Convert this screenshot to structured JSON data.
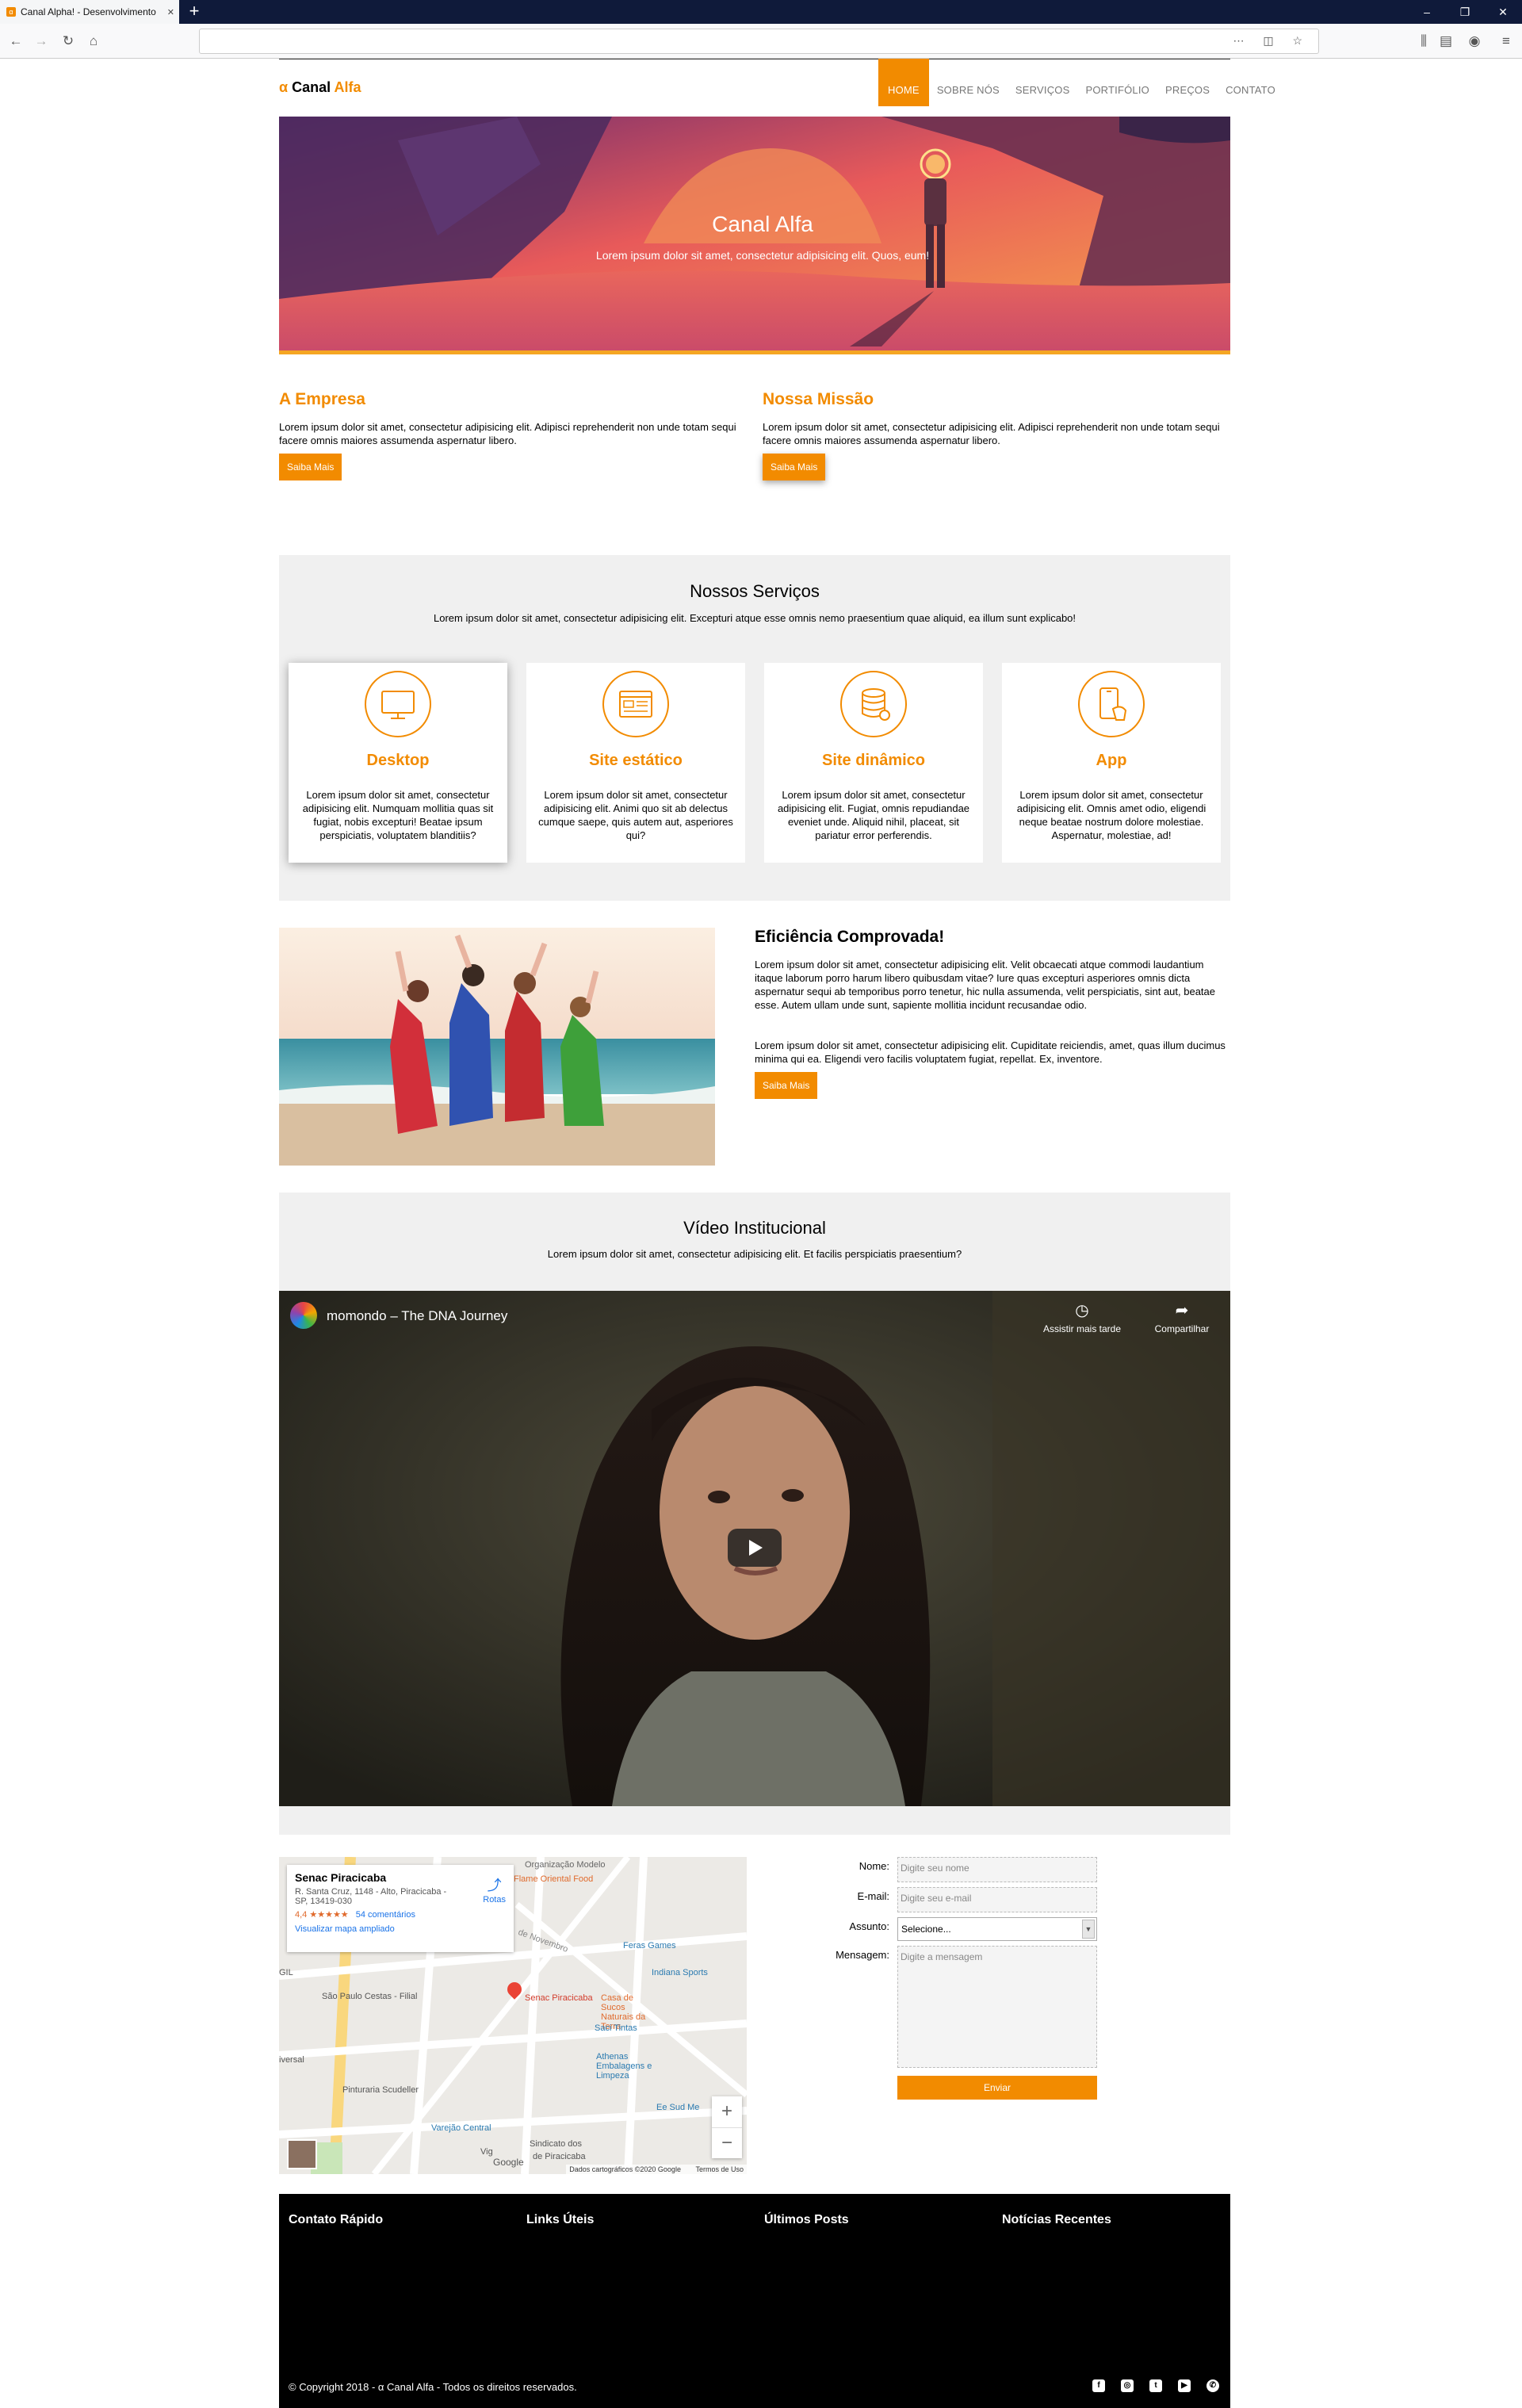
{
  "browser": {
    "tab_title": "Canal Alpha! - Desenvolvimento",
    "new_tab": "+",
    "url": "",
    "win_min": "–",
    "win_max": "❐",
    "win_close": "✕"
  },
  "header": {
    "logo_symbol": "α",
    "logo_canal": "Canal",
    "logo_alfa": "Alfa",
    "menu": [
      "HOME",
      "SOBRE NÓS",
      "SERVIÇOS",
      "PORTIFÓLIO",
      "PREÇOS",
      "CONTATO"
    ]
  },
  "hero": {
    "title": "Canal Alfa",
    "subtitle": "Lorem ipsum dolor sit amet, consectetur adipisicing elit. Quos, eum!"
  },
  "about": [
    {
      "title": "A Empresa",
      "text": "Lorem ipsum dolor sit amet, consectetur adipisicing elit. Adipisci reprehenderit non unde totam sequi facere omnis maiores assumenda aspernatur libero.",
      "button": "Saiba Mais"
    },
    {
      "title": "Nossa Missão",
      "text": "Lorem ipsum dolor sit amet, consectetur adipisicing elit. Adipisci reprehenderit non unde totam sequi facere omnis maiores assumenda aspernatur libero.",
      "button": "Saiba Mais"
    }
  ],
  "services": {
    "title": "Nossos Serviços",
    "subtitle": "Lorem ipsum dolor sit amet, consectetur adipisicing elit. Excepturi atque esse omnis nemo praesentium quae aliquid, ea illum sunt explicabo!",
    "cards": [
      {
        "icon": "desktop-icon",
        "title": "Desktop",
        "text": "Lorem ipsum dolor sit amet, consectetur adipisicing elit. Numquam mollitia quas sit fugiat, nobis excepturi! Beatae ipsum perspiciatis, voluptatem blanditiis?"
      },
      {
        "icon": "static-site-icon",
        "title": "Site estático",
        "text": "Lorem ipsum dolor sit amet, consectetur adipisicing elit. Animi quo sit ab delectus cumque saepe, quis autem aut, asperiores qui?"
      },
      {
        "icon": "database-icon",
        "title": "Site dinâmico",
        "text": "Lorem ipsum dolor sit amet, consectetur adipisicing elit. Fugiat, omnis repudiandae eveniet unde. Aliquid nihil, placeat, sit pariatur error perferendis."
      },
      {
        "icon": "mobile-app-icon",
        "title": "App",
        "text": "Lorem ipsum dolor sit amet, consectetur adipisicing elit. Omnis amet odio, eligendi neque beatae nostrum dolore molestiae. Aspernatur, molestiae, ad!"
      }
    ]
  },
  "efficiency": {
    "title": "Eficiência Comprovada!",
    "p1": "Lorem ipsum dolor sit amet, consectetur adipisicing elit. Velit obcaecati atque commodi laudantium itaque laborum porro harum libero quibusdam vitae? Iure quas excepturi asperiores omnis dicta aspernatur sequi ab temporibus porro tenetur, hic nulla assumenda, velit perspiciatis, sint aut, beatae esse. Autem ullam unde sunt, sapiente mollitia incidunt recusandae odio.",
    "p2": "Lorem ipsum dolor sit amet, consectetur adipisicing elit. Cupiditate reiciendis, amet, quas illum ducimus minima qui ea. Eligendi vero facilis voluptatem fugiat, repellat. Ex, inventore.",
    "button": "Saiba Mais"
  },
  "video": {
    "title": "Vídeo Institucional",
    "subtitle": "Lorem ipsum dolor sit amet, consectetur adipisicing elit. Et facilis perspiciatis praesentium?",
    "video_title": "momondo – The DNA Journey",
    "watch_later": "Assistir mais tarde",
    "share": "Compartilhar"
  },
  "map": {
    "place": "Senac Piracicaba",
    "address": "R. Santa Cruz, 1148 - Alto, Piracicaba - SP, 13419-030",
    "rating": "4,4",
    "stars": "★★★★★",
    "reviews": "54 comentários",
    "enlarge": "Visualizar mapa ampliado",
    "directions": "Rotas",
    "labels": [
      "Organização Modelo",
      "Flame Oriental Food",
      "de Novembro",
      "Feras Games",
      "Indiana Sports",
      "GIL",
      "São Paulo Cestas - Filial",
      "Senac Piracicaba",
      "Casa de Sucos Naturais da Terra",
      "Saci Tintas",
      "Athenas Embalagens e Limpeza",
      "iversal",
      "Pinturaria Scudeller",
      "Ee Sud Me",
      "Varejão Central",
      "Sindicato dos",
      "Vig",
      "de Piracicaba"
    ],
    "zoom_in": "+",
    "zoom_out": "−",
    "google": "Google",
    "map_data": "Dados cartográficos ©2020 Google",
    "terms": "Termos de Uso"
  },
  "form": {
    "name_label": "Nome:",
    "name_placeholder": "Digite seu nome",
    "email_label": "E-mail:",
    "email_placeholder": "Digite seu e-mail",
    "subject_label": "Assunto:",
    "subject_value": "Selecione...",
    "message_label": "Mensagem:",
    "message_placeholder": "Digite a mensagem",
    "submit": "Enviar"
  },
  "footer": {
    "columns": [
      "Contato Rápido",
      "Links Úteis",
      "Últimos Posts",
      "Notícias Recentes"
    ],
    "copyright": "© Copyright 2018 - α Canal Alfa - Todos os direitos reservados.",
    "social": [
      "facebook-icon",
      "instagram-icon",
      "twitter-icon",
      "youtube-icon",
      "whatsapp-icon"
    ]
  },
  "colors": {
    "accent": "#f28b00",
    "footer": "#000000",
    "section_bg": "#f0f0f0"
  }
}
